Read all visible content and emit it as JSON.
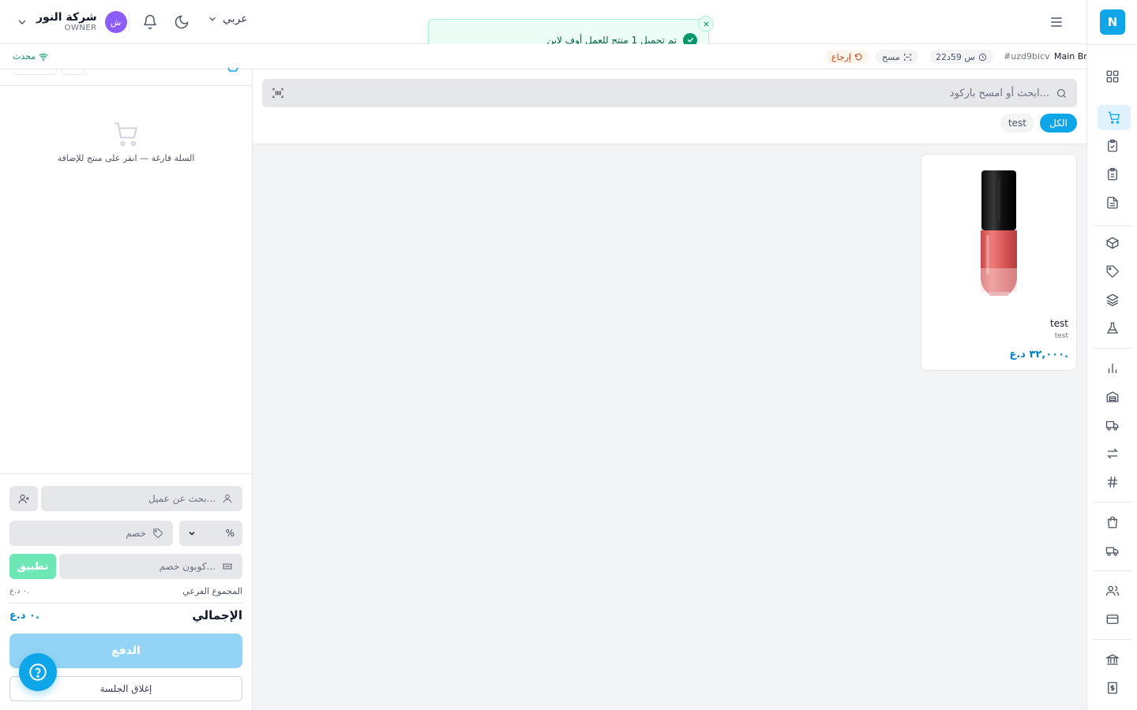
{
  "app": {
    "logo_letter": "N"
  },
  "header": {
    "user_name": "شركة النور",
    "user_role": "OWNER",
    "avatar_initial": "ش",
    "language": "عربي"
  },
  "toast": {
    "message": "تم تحميل 1 منتج للعمل أوف لاين"
  },
  "session_bar": {
    "branch": "Main Branch",
    "session_id": "#uzd9bicv",
    "duration": "22س 59د",
    "scan_label": "مسح",
    "return_label": "إرجاع",
    "sync_status": "محدث"
  },
  "search": {
    "placeholder": "ابحث أو امسح باركود..."
  },
  "categories": [
    {
      "label": "الكل",
      "active": true
    },
    {
      "label": "test",
      "active": false
    }
  ],
  "products": [
    {
      "name": "test",
      "subtitle": "test",
      "price": "٣٢,٠٠٠ د.ع."
    }
  ],
  "cart": {
    "empty_message": "السلة فارغة — انقر على منتج للإضافة",
    "customer_placeholder": "بحث عن عميل...",
    "discount_placeholder": "خصم",
    "discount_type": "%",
    "coupon_placeholder": "كوبون خصم...",
    "apply_label": "تطبيق",
    "subtotal_label": "المجموع الفرعي",
    "subtotal_value": "٠ د.ع.",
    "total_label": "الإجمالي",
    "total_value": "٠ د.ع.",
    "pay_label": "الدفع",
    "close_session_label": "إغلاق الجلسة"
  },
  "colors": {
    "accent": "#0ea5e9",
    "success": "#059669",
    "avatar": "#8b5cf6",
    "return_chip": "#c2410c"
  },
  "icons": {
    "rail": [
      "dashboard-icon",
      "cart-icon",
      "clipboard-check-icon",
      "clipboard-icon",
      "file-text-icon",
      "box-icon",
      "tag-icon",
      "layers-icon",
      "flask-icon",
      "bar-chart-icon",
      "warehouse-icon",
      "truck-icon",
      "transfer-icon",
      "hash-icon",
      "shopping-bag-icon",
      "delivery-truck-icon",
      "users-icon",
      "credit-card-icon",
      "bank-icon",
      "receipt-icon"
    ]
  }
}
